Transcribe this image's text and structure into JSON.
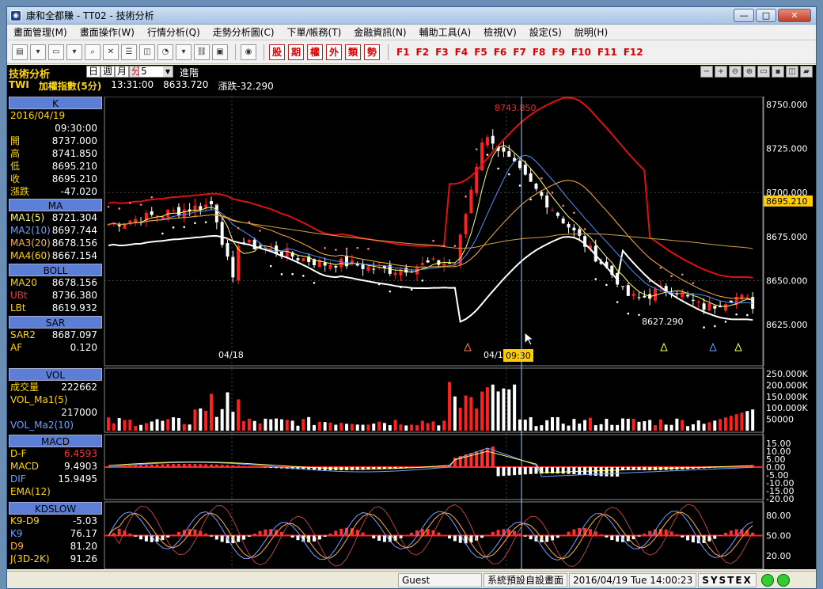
{
  "window": {
    "title": "康和全都賺 - TT02 - 技術分析",
    "min": "—",
    "max": "□",
    "close": "✕"
  },
  "menu": [
    "畫面管理(M)",
    "畫面操作(W)",
    "行情分析(Q)",
    "走勢分析圖(C)",
    "下單/帳務(T)",
    "金融資訊(N)",
    "輔助工具(A)",
    "檢視(V)",
    "設定(S)",
    "說明(H)"
  ],
  "toolbar": {
    "red_buttons": [
      "股",
      "期",
      "權",
      "外",
      "類",
      "勢"
    ],
    "fkeys": [
      "F1",
      "F2",
      "F3",
      "F4",
      "F5",
      "F6",
      "F7",
      "F8",
      "F9",
      "F10",
      "F11",
      "F12"
    ]
  },
  "header": {
    "title": "技術分析",
    "periods": [
      "日",
      "週",
      "月",
      "分"
    ],
    "period_value": "5",
    "advanced": "進階",
    "symbol": "TWI",
    "name": "加權指數(5分)",
    "time": "13:31:00",
    "price": "8633.720",
    "change_label": "漲跌",
    "change": "-32.290"
  },
  "panels": {
    "k": {
      "title": "K",
      "date": "2016/04/19",
      "time": "09:30:00",
      "rows": [
        {
          "l": "開",
          "v": "8737.000"
        },
        {
          "l": "高",
          "v": "8741.850"
        },
        {
          "l": "低",
          "v": "8695.210"
        },
        {
          "l": "收",
          "v": "8695.210"
        },
        {
          "l": "漲跌",
          "v": "-47.020"
        }
      ]
    },
    "ma": {
      "title": "MA",
      "rows": [
        {
          "l": "MA1(5)",
          "v": "8721.304"
        },
        {
          "l": "MA2(10)",
          "v": "8697.744"
        },
        {
          "l": "MA3(20)",
          "v": "8678.156"
        },
        {
          "l": "MA4(60)",
          "v": "8667.154"
        }
      ]
    },
    "boll": {
      "title": "BOLL",
      "rows": [
        {
          "l": "MA20",
          "v": "8678.156"
        },
        {
          "l": "UBt",
          "v": "8736.380"
        },
        {
          "l": "LBt",
          "v": "8619.932"
        }
      ]
    },
    "sar": {
      "title": "SAR",
      "rows": [
        {
          "l": "SAR2",
          "v": "8687.097"
        },
        {
          "l": "AF",
          "v": "0.120"
        }
      ]
    },
    "vol": {
      "title": "VOL",
      "rows": [
        {
          "l": "成交量",
          "v": "222662"
        },
        {
          "l": "VOL_Ma1(5)",
          "v": ""
        },
        {
          "l": "",
          "v": "217000"
        },
        {
          "l": "VOL_Ma2(10)",
          "v": ""
        }
      ]
    },
    "macd": {
      "title": "MACD",
      "rows": [
        {
          "l": "D-F",
          "v": "6.4593"
        },
        {
          "l": "MACD",
          "v": "9.4903"
        },
        {
          "l": "DIF",
          "v": "15.9495"
        },
        {
          "l": "EMA(12)",
          "v": ""
        }
      ]
    },
    "kd": {
      "title": "KDSLOW",
      "rows": [
        {
          "l": "K9-D9",
          "v": "-5.03"
        },
        {
          "l": "K9",
          "v": "76.17"
        },
        {
          "l": "D9",
          "v": "81.20"
        },
        {
          "l": "J(3D-2K)",
          "v": "91.26"
        }
      ]
    }
  },
  "chart": {
    "price_ticks": [
      "8750.000",
      "8725.000",
      "8700.000",
      "8675.000",
      "8650.000",
      "8625.000"
    ],
    "current_price_tag": "8695.210",
    "high_label": "8743.850",
    "low_label": "8627.290",
    "date_labels": [
      "04/18",
      "04/19"
    ],
    "cursor_time": "09:30",
    "vol_ticks": [
      "250.000K",
      "200.000K",
      "150.000K",
      "100.000K",
      "50000"
    ],
    "macd_ticks": [
      "15.00",
      "10.00",
      "5.00",
      "0.00",
      "-5.00",
      "-10.00",
      "-15.00",
      "-20.00"
    ],
    "kd_ticks": [
      "80.00",
      "50.00",
      "20.00"
    ],
    "colors": {
      "up": "#ff2020",
      "down": "#ffffff",
      "boll_upper": "#e01010",
      "boll_lower": "#ffffff",
      "ma5": "#ffff66",
      "ma10": "#4f8fff",
      "ma20": "#ffb040",
      "ma60": "#d0a040"
    }
  },
  "status": {
    "user": "Guest",
    "layout": "系統預設自設畫面",
    "datetime": "2016/04/19 Tue 14:00:23",
    "brand": "SYSTEX"
  }
}
